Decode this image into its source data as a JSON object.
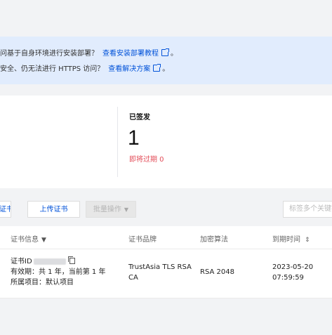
{
  "notice": {
    "line1_text": "问基于自身环境进行安装部署？",
    "line1_link": "查看安装部署教程",
    "line1_tail": "。",
    "line2_text": "安全、仍无法进行 HTTPS 访问？",
    "line2_link": "查看解决方案",
    "line2_tail": "。"
  },
  "stats": {
    "signed_label": "已签发",
    "signed_count": "1",
    "expiring_text": "即将过期 0"
  },
  "toolbar": {
    "cut_button": "证书",
    "upload_button": "上传证书",
    "batch_button": "批量操作",
    "search_placeholder": "标签多个关键字"
  },
  "table": {
    "headers": {
      "cert_info": "证书信息",
      "brand": "证书品牌",
      "algorithm": "加密算法",
      "expiry": "到期时间"
    },
    "rows": [
      {
        "cert_id_label": "证书ID",
        "validity": "有效期：共 1 年，当前第 1 年",
        "project": "所属项目：默认项目",
        "brand_line1": "TrustAsia TLS RSA",
        "brand_line2": "CA",
        "algorithm": "RSA 2048",
        "expiry_date": "2023-05-20",
        "expiry_time": "07:59:59"
      }
    ]
  },
  "colors": {
    "accent": "#0052d9",
    "danger": "#e34d59",
    "notice_bg": "#e1ecfd"
  }
}
